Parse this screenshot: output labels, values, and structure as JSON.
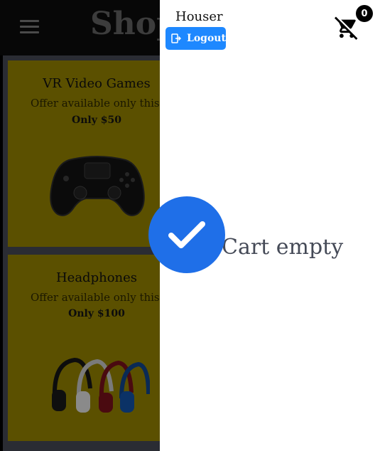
{
  "app": {
    "title": "Shop"
  },
  "products": [
    {
      "title": "VR Video Games",
      "offer": "Offer available only this week",
      "price": "Only $50",
      "image": "gamepad-image"
    },
    {
      "title": "Headphones",
      "offer": "Offer available only this week",
      "price": "Only $100",
      "image": "headphones-image"
    }
  ],
  "drawer": {
    "username": "Houser",
    "logout_label": "Logout",
    "cart_count": "0",
    "empty_message": "Cart empty",
    "icons": [
      "logout-icon",
      "cart-off-icon",
      "check-icon"
    ]
  },
  "colors": {
    "accent": "#1e88ff",
    "check": "#1f6fe8",
    "card": "#f0d000",
    "drawer_bg": "#ffffff"
  }
}
